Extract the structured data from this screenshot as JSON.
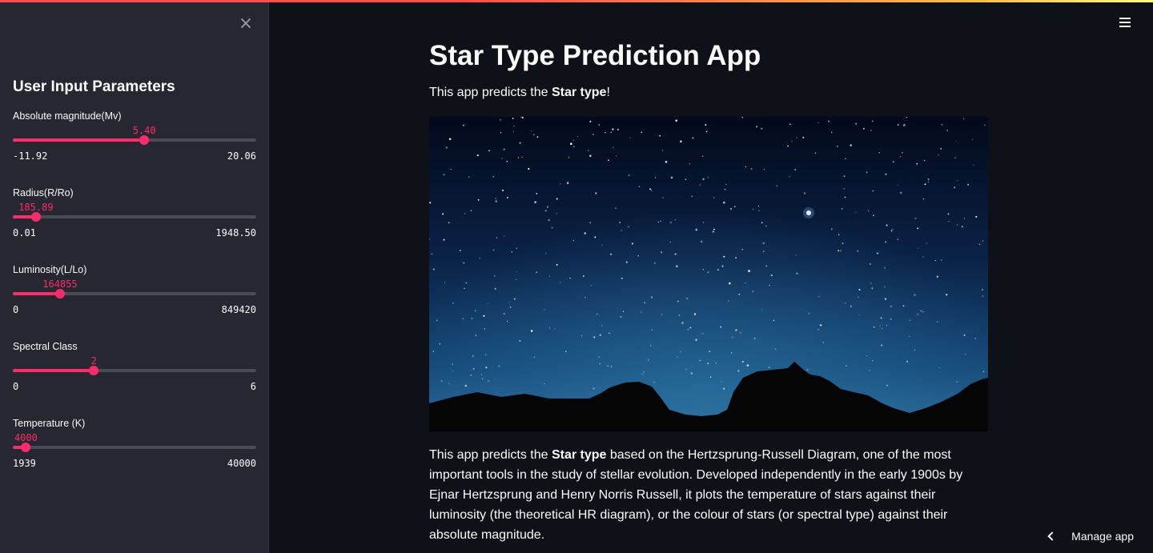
{
  "sidebar": {
    "close_glyph": "×",
    "title": "User Input Parameters",
    "sliders": [
      {
        "label": "Absolute magnitude(Mv)",
        "value": "5.40",
        "min": "-11.92",
        "max": "20.06",
        "position": 0.54
      },
      {
        "label": "Radius(R/Ro)",
        "value": "185.89",
        "min": "0.01",
        "max": "1948.50",
        "position": 0.095
      },
      {
        "label": "Luminosity(L/Lo)",
        "value": "164855",
        "min": "0",
        "max": "849420",
        "position": 0.194
      },
      {
        "label": "Spectral Class",
        "value": "2",
        "min": "0",
        "max": "6",
        "position": 0.333
      },
      {
        "label": "Temperature (K)",
        "value": "4000",
        "min": "1939",
        "max": "40000",
        "position": 0.054
      }
    ]
  },
  "header": {
    "menu_icon": "hamburger-menu-icon"
  },
  "main": {
    "title": "Star Type Prediction App",
    "intro_prefix": "This app predicts the ",
    "intro_bold": "Star type",
    "intro_suffix": "!",
    "image_icon": "night-sky-image",
    "para_prefix": "This app predicts the ",
    "para_bold": "Star type",
    "para_suffix": " based on the Hertzsprung-Russell Diagram, one of the most important tools in the study of stellar evolution. Developed independently in the early 1900s by Ejnar Hertzsprung and Henry Norris Russell, it plots the temperature of stars against their luminosity (the theoretical HR diagram), or the colour of stars (or spectral type) against their absolute magnitude."
  },
  "footer": {
    "manage_label": "Manage app"
  },
  "colors": {
    "accent": "#ff2b6a",
    "sidebar_bg": "#262730",
    "main_bg": "#0e1117"
  }
}
